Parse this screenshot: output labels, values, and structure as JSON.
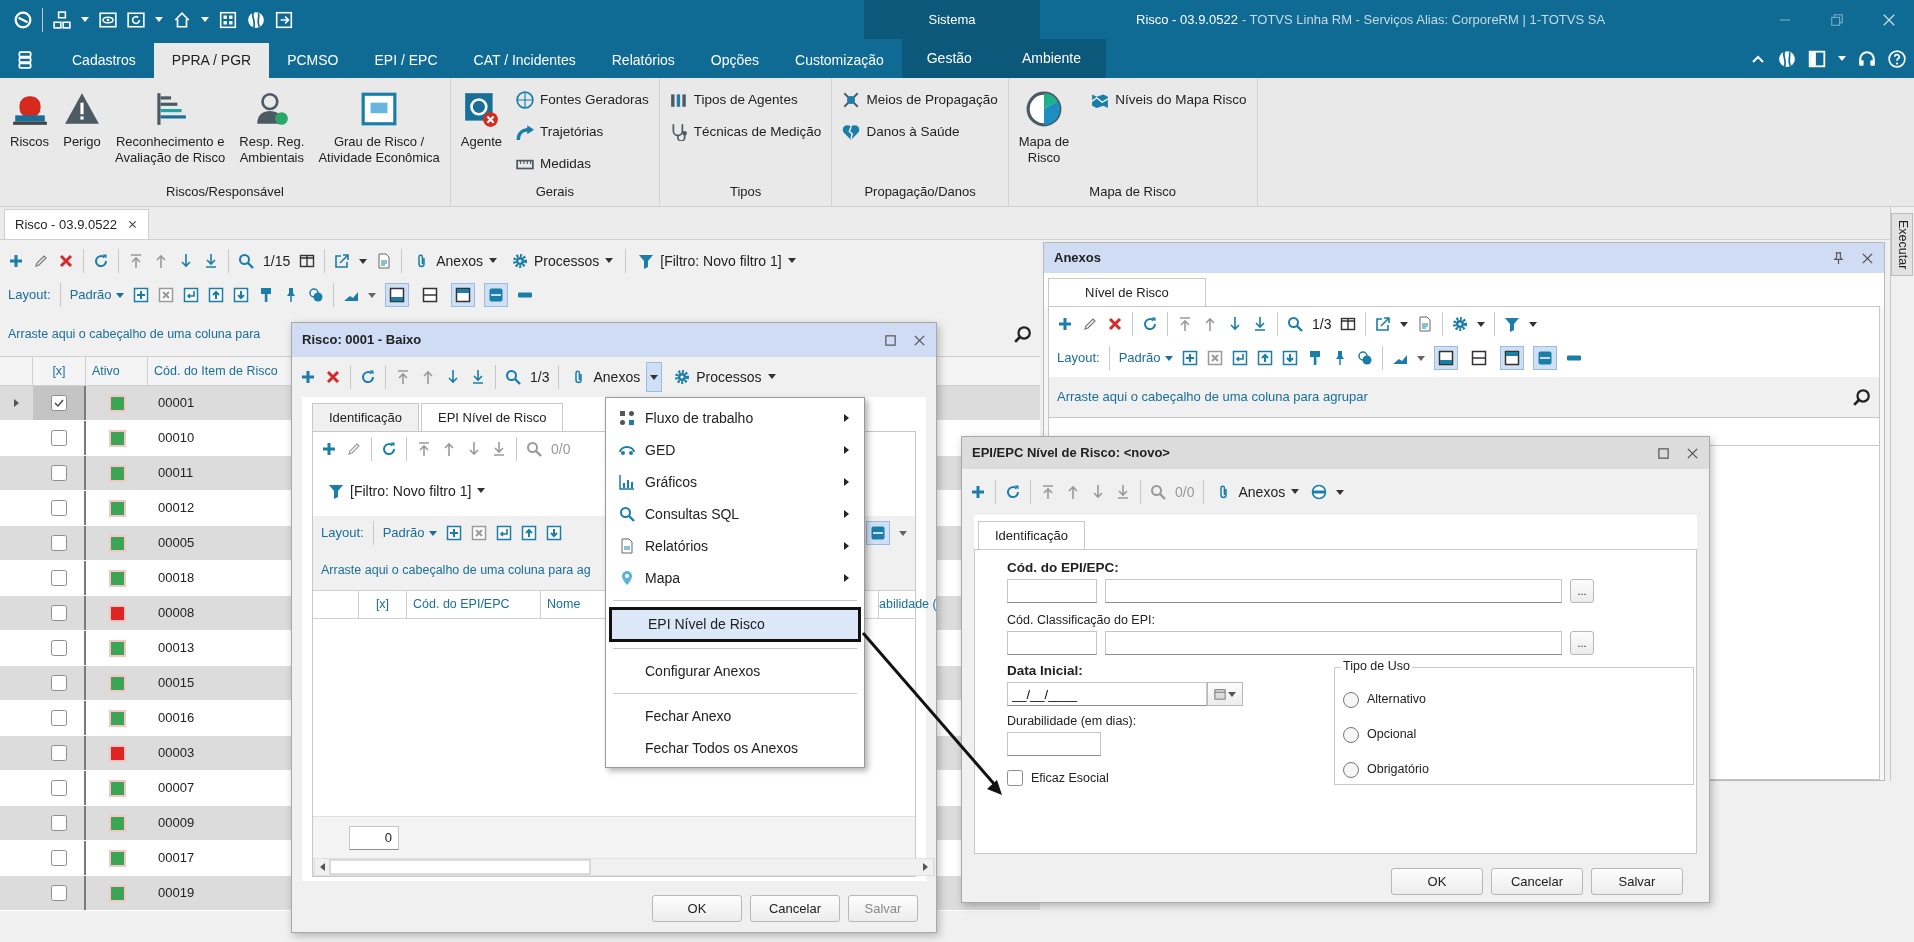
{
  "title_bar": {
    "section": "Sistema",
    "title": "Risco - 03.9.0522",
    "subtitle": "- TOTVS Linha RM - Serviços  Alias: CorporeRM | 1-TOTVS SA"
  },
  "menu_tabs": [
    {
      "label": "Cadastros",
      "selected": false,
      "contextual": false
    },
    {
      "label": "PPRA / PGR",
      "selected": true,
      "contextual": false
    },
    {
      "label": "PCMSO",
      "selected": false,
      "contextual": false
    },
    {
      "label": "EPI / EPC",
      "selected": false,
      "contextual": false
    },
    {
      "label": "CAT / Incidentes",
      "selected": false,
      "contextual": false
    },
    {
      "label": "Relatórios",
      "selected": false,
      "contextual": false
    },
    {
      "label": "Opções",
      "selected": false,
      "contextual": false
    },
    {
      "label": "Customização",
      "selected": false,
      "contextual": false
    },
    {
      "label": "Gestão",
      "selected": false,
      "contextual": true
    },
    {
      "label": "Ambiente",
      "selected": false,
      "contextual": true
    }
  ],
  "ribbon": [
    {
      "label": "Riscos/Responsável",
      "buttons": [
        {
          "label": "Riscos",
          "kind": "large"
        },
        {
          "label": "Perigo",
          "kind": "large"
        },
        {
          "label": "Reconhecimento e\nAvaliação de Risco",
          "kind": "large"
        },
        {
          "label": "Resp. Reg.\nAmbientais",
          "kind": "large"
        },
        {
          "label": "Grau de Risco /\nAtividade Econômica",
          "kind": "large"
        }
      ]
    },
    {
      "label": "Gerais",
      "buttons": [
        {
          "label": "Agente",
          "kind": "large"
        },
        {
          "label": "Fontes Geradoras",
          "kind": "small"
        },
        {
          "label": "Trajetórias",
          "kind": "small"
        },
        {
          "label": "Medidas",
          "kind": "small"
        }
      ]
    },
    {
      "label": "Tipos",
      "buttons": [
        {
          "label": "Tipos de Agentes",
          "kind": "small"
        },
        {
          "label": "Técnicas de Medição",
          "kind": "small"
        }
      ]
    },
    {
      "label": "Propagação/Danos",
      "buttons": [
        {
          "label": "Meios de Propagação",
          "kind": "small"
        },
        {
          "label": "Danos à Saúde",
          "kind": "small"
        }
      ]
    },
    {
      "label": "Mapa de Risco",
      "buttons": [
        {
          "label": "Mapa de\nRisco",
          "kind": "large"
        },
        {
          "label": "Níveis do Mapa Risco",
          "kind": "small"
        }
      ]
    }
  ],
  "document_tab": {
    "label": "Risco - 03.9.0522"
  },
  "main": {
    "toolbar": {
      "counter": "1/15",
      "attachments": "Anexos",
      "processes": "Processos",
      "filter": "[Filtro: Novo filtro 1]"
    },
    "layout": {
      "label": "Layout:",
      "value": "Padrão",
      "pane_toggles": [
        {
          "selected": true
        },
        {
          "selected": false
        },
        {
          "selected": true
        },
        {
          "selected": true
        }
      ]
    },
    "group_hint": "Arraste aqui o cabeçalho de uma coluna para",
    "columns": [
      "[x]",
      "Ativo",
      "Cód. do Item de Risco"
    ],
    "rows": [
      {
        "code": "00001",
        "checked": true,
        "selected": true,
        "color": "#3aa655"
      },
      {
        "code": "00010",
        "checked": false,
        "selected": false,
        "color": "#3aa655"
      },
      {
        "code": "00011",
        "checked": false,
        "selected": false,
        "color": "#3aa655"
      },
      {
        "code": "00012",
        "checked": false,
        "selected": false,
        "color": "#3aa655"
      },
      {
        "code": "00005",
        "checked": false,
        "selected": false,
        "color": "#3aa655"
      },
      {
        "code": "00018",
        "checked": false,
        "selected": false,
        "color": "#3aa655"
      },
      {
        "code": "00008",
        "checked": false,
        "selected": false,
        "color": "#e02424"
      },
      {
        "code": "00013",
        "checked": false,
        "selected": false,
        "color": "#3aa655"
      },
      {
        "code": "00015",
        "checked": false,
        "selected": false,
        "color": "#3aa655"
      },
      {
        "code": "00016",
        "checked": false,
        "selected": false,
        "color": "#3aa655"
      },
      {
        "code": "00003",
        "checked": false,
        "selected": false,
        "color": "#e02424"
      },
      {
        "code": "00007",
        "checked": false,
        "selected": false,
        "color": "#3aa655"
      },
      {
        "code": "00009",
        "checked": false,
        "selected": false,
        "color": "#3aa655"
      },
      {
        "code": "00017",
        "checked": false,
        "selected": false,
        "color": "#3aa655"
      },
      {
        "code": "00019",
        "checked": false,
        "selected": false,
        "color": "#3aa655"
      }
    ]
  },
  "risk_dialog": {
    "title": "Risco: 0001 - Baixo",
    "toolbar": {
      "counter": "1/3",
      "attachments": "Anexos",
      "processes": "Processos"
    },
    "tabs": [
      {
        "label": "Identificação",
        "selected": false
      },
      {
        "label": "EPI Nível de Risco",
        "selected": true
      }
    ],
    "inner_toolbar": {
      "counter": "0/0"
    },
    "filter": "[Filtro: Novo filtro 1]",
    "layout": {
      "label": "Layout:",
      "value": "Padrão",
      "pane_toggles": [
        {
          "selected": true
        }
      ]
    },
    "group_hint": "Arraste aqui o cabeçalho de uma coluna para ag",
    "columns": [
      "[x]",
      "Cód. do EPI/EPC",
      "Nome",
      "abilidade ("
    ],
    "record_count": "0",
    "buttons": [
      {
        "label": "OK",
        "disabled": false
      },
      {
        "label": "Cancelar",
        "disabled": false
      },
      {
        "label": "Salvar",
        "disabled": true
      }
    ]
  },
  "attachments_menu": {
    "groups": [
      [
        {
          "label": "Fluxo de trabalho",
          "submenu": true,
          "selected": false
        },
        {
          "label": "GED",
          "submenu": true,
          "selected": false
        },
        {
          "label": "Gráficos",
          "submenu": true,
          "selected": false
        },
        {
          "label": "Consultas SQL",
          "submenu": true,
          "selected": false
        },
        {
          "label": "Relatórios",
          "submenu": true,
          "selected": false
        },
        {
          "label": "Mapa",
          "submenu": true,
          "selected": false
        }
      ],
      [
        {
          "label": "EPI Nível de Risco",
          "submenu": false,
          "selected": true
        }
      ],
      [
        {
          "label": "Configurar Anexos",
          "submenu": false,
          "selected": false
        }
      ],
      [
        {
          "label": "Fechar Anexo",
          "submenu": false,
          "selected": false
        },
        {
          "label": "Fechar Todos os Anexos",
          "submenu": false,
          "selected": false
        }
      ]
    ]
  },
  "attachments_panel": {
    "title": "Anexos",
    "tabs": [
      {
        "label": "Nível de Risco",
        "selected": true
      }
    ],
    "toolbar": {
      "counter": "1/3"
    },
    "layout": {
      "label": "Layout:",
      "value": "Padrão",
      "pane_toggles": [
        {
          "selected": true
        },
        {
          "selected": false
        },
        {
          "selected": true
        },
        {
          "selected": true
        }
      ]
    },
    "group_hint": "Arraste aqui o cabeçalho de uma coluna para agrupar"
  },
  "epi_dialog": {
    "title": "EPI/EPC Nível de Risco: <novo>",
    "toolbar": {
      "counter": "0/0",
      "attachments": "Anexos"
    },
    "tabs": [
      {
        "label": "Identificação",
        "selected": true
      }
    ],
    "epi_code": {
      "label": "Cód. do EPI/EPC:",
      "required": true
    },
    "classification": {
      "label": "Cód. Classificação do EPI:",
      "required": false
    },
    "start_date": {
      "label": "Data Inicial:",
      "required": true,
      "value": "__/__/____"
    },
    "durability": {
      "label": "Durabilidade (em dias):",
      "required": false
    },
    "lookup_button": "...",
    "effective": {
      "label": "Eficaz Esocial",
      "checked": false
    },
    "usage_type": {
      "label": "Tipo de Uso",
      "options": [
        {
          "label": "Alternativo",
          "selected": false
        },
        {
          "label": "Opcional",
          "selected": false
        },
        {
          "label": "Obrigatório",
          "selected": false
        }
      ]
    },
    "buttons": [
      {
        "label": "OK",
        "disabled": false
      },
      {
        "label": "Cancelar",
        "disabled": false
      },
      {
        "label": "Salvar",
        "disabled": false
      }
    ]
  },
  "side_tab": {
    "label": "Executar"
  }
}
